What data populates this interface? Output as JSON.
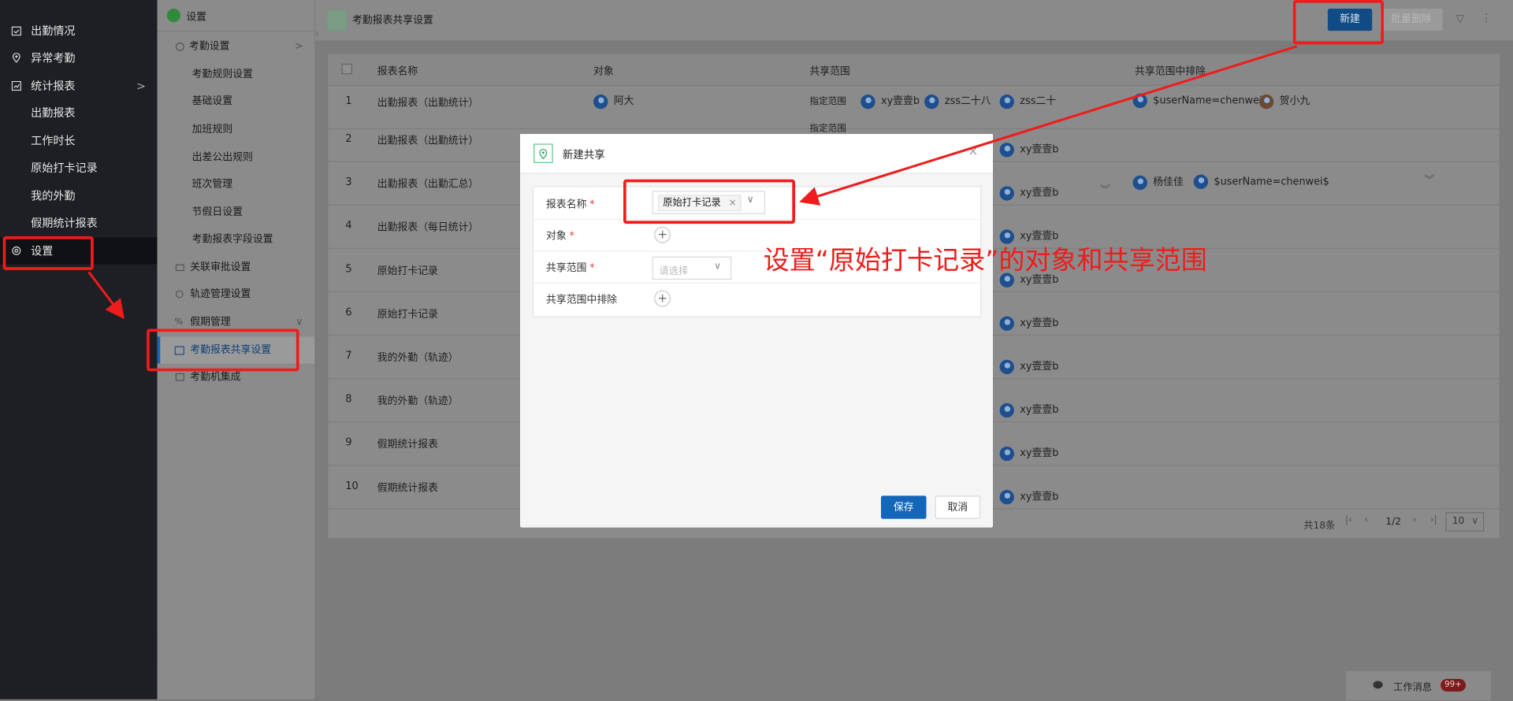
{
  "colors": {
    "primary": "#1466b8",
    "annotation": "#ee1c1c",
    "nav_bg": "#1d1f24",
    "dim_overlay": "#7c7c7c"
  },
  "nav": {
    "items": [
      {
        "label": "出勤情况",
        "icon": "calendar-check-icon"
      },
      {
        "label": "异常考勤",
        "icon": "location-pin-icon"
      },
      {
        "label": "统计报表",
        "icon": "report-icon",
        "chevron": ">"
      },
      {
        "label": "出勤报表"
      },
      {
        "label": "工作时长"
      },
      {
        "label": "原始打卡记录"
      },
      {
        "label": "我的外勤"
      },
      {
        "label": "假期统计报表"
      },
      {
        "label": "设置",
        "icon": "gear-icon",
        "active": true
      }
    ]
  },
  "settings": {
    "title": "设置",
    "items": [
      {
        "label": "考勤设置",
        "icon": "attendance-icon",
        "chevron": ">"
      },
      {
        "label": "考勤规则设置"
      },
      {
        "label": "基础设置"
      },
      {
        "label": "加班规则"
      },
      {
        "label": "出差公出规则"
      },
      {
        "label": "班次管理"
      },
      {
        "label": "节假日设置"
      },
      {
        "label": "考勤报表字段设置"
      },
      {
        "label": "关联审批设置",
        "icon": "layers-icon"
      },
      {
        "label": "轨迹管理设置",
        "icon": "route-icon"
      },
      {
        "label": "假期管理",
        "icon": "percent-icon",
        "chevron": "∨"
      },
      {
        "label": "考勤报表共享设置",
        "icon": "share-report-icon",
        "active": true
      },
      {
        "label": "考勤机集成",
        "icon": "machine-icon"
      }
    ]
  },
  "page": {
    "title": "考勤报表共享设置",
    "new_button": "新建",
    "batch_delete_button": "批量删除"
  },
  "table": {
    "headers": [
      "报表名称",
      "对象",
      "共享范围",
      "共享范围中排除"
    ],
    "rows": [
      {
        "index": "1",
        "name": "出勤报表（出勤统计）",
        "object": "阿大",
        "scope_label": "指定范围",
        "scope": [
          "xy壹壹b",
          "zss二十八",
          "zss二十"
        ],
        "exclude": [
          "$userName=chenwei$",
          "贺小九"
        ]
      },
      {
        "index": "2",
        "name": "出勤报表（出勤统计）",
        "scope_label": "指定范围",
        "scope": [
          "xy壹壹b"
        ]
      },
      {
        "index": "3",
        "name": "出勤报表（出勤汇总）",
        "scope": [
          "xy壹壹b"
        ],
        "exclude": [
          "杨佳佳",
          "$userName=chenwei$"
        ]
      },
      {
        "index": "4",
        "name": "出勤报表（每日统计）",
        "scope": [
          "xy壹壹b"
        ]
      },
      {
        "index": "5",
        "name": "原始打卡记录",
        "scope": [
          "xy壹壹b"
        ]
      },
      {
        "index": "6",
        "name": "原始打卡记录",
        "scope": [
          "xy壹壹b"
        ]
      },
      {
        "index": "7",
        "name": "我的外勤（轨迹）",
        "scope": [
          "xy壹壹b"
        ]
      },
      {
        "index": "8",
        "name": "我的外勤（轨迹）",
        "scope": [
          "xy壹壹b"
        ]
      },
      {
        "index": "9",
        "name": "假期统计报表",
        "scope": [
          "xy壹壹b"
        ]
      },
      {
        "index": "10",
        "name": "假期统计报表",
        "scope": [
          "xy壹壹b"
        ]
      }
    ]
  },
  "pagination": {
    "total": "共18条",
    "page": "1/2",
    "page_size": "10"
  },
  "modal": {
    "title": "新建共享",
    "fields": [
      {
        "label": "报表名称",
        "required": true,
        "tag": "原始打卡记录"
      },
      {
        "label": "对象",
        "required": true
      },
      {
        "label": "共享范围",
        "required": true,
        "placeholder": "请选择"
      },
      {
        "label": "共享范围中排除",
        "required": false
      }
    ],
    "save_button": "保存",
    "cancel_button": "取消"
  },
  "annotation": {
    "text": "设置“原始打卡记录”的对象和共享范围"
  },
  "messages": {
    "label": "工作消息",
    "badge": "99+"
  }
}
